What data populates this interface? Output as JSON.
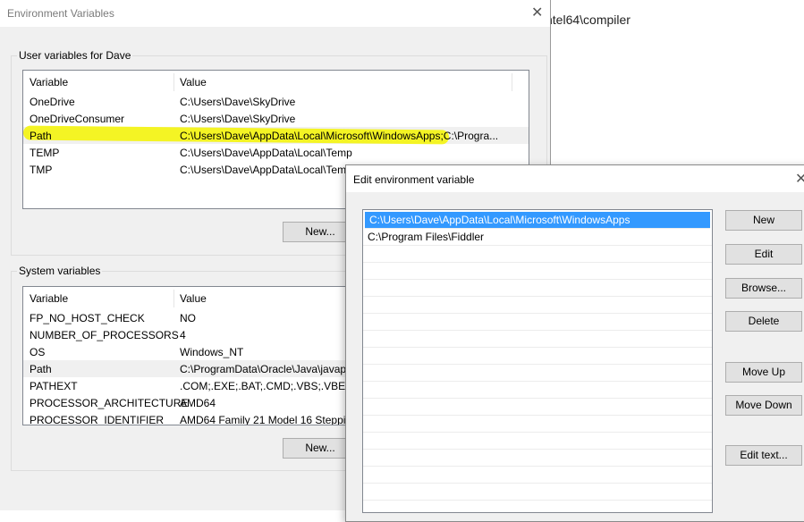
{
  "background": {
    "partial_path_text": "ntel64\\compiler"
  },
  "env_window": {
    "title": "Environment Variables",
    "user_group": {
      "label": "User variables for Dave",
      "columns": [
        "Variable",
        "Value"
      ],
      "rows": [
        {
          "variable": "OneDrive",
          "value": "C:\\Users\\Dave\\SkyDrive"
        },
        {
          "variable": "OneDriveConsumer",
          "value": "C:\\Users\\Dave\\SkyDrive"
        },
        {
          "variable": "Path",
          "value": "C:\\Users\\Dave\\AppData\\Local\\Microsoft\\WindowsApps;C:\\Progra..."
        },
        {
          "variable": "TEMP",
          "value": "C:\\Users\\Dave\\AppData\\Local\\Temp"
        },
        {
          "variable": "TMP",
          "value": "C:\\Users\\Dave\\AppData\\Local\\Temp"
        }
      ],
      "new_button": "New..."
    },
    "system_group": {
      "label": "System variables",
      "columns": [
        "Variable",
        "Value"
      ],
      "rows": [
        {
          "variable": "FP_NO_HOST_CHECK",
          "value": "NO"
        },
        {
          "variable": "NUMBER_OF_PROCESSORS",
          "value": "4"
        },
        {
          "variable": "OS",
          "value": "Windows_NT"
        },
        {
          "variable": "Path",
          "value": "C:\\ProgramData\\Oracle\\Java\\javapath"
        },
        {
          "variable": "PATHEXT",
          "value": ".COM;.EXE;.BAT;.CMD;.VBS;.VBE;.JS;"
        },
        {
          "variable": "PROCESSOR_ARCHITECTURE",
          "value": "AMD64"
        },
        {
          "variable": "PROCESSOR_IDENTIFIER",
          "value": "AMD64 Family 21 Model 16 Stepping"
        }
      ],
      "new_button": "New..."
    }
  },
  "edit_dialog": {
    "title": "Edit environment variable",
    "entries": [
      {
        "text": "C:\\Users\\Dave\\AppData\\Local\\Microsoft\\WindowsApps",
        "selected": true
      },
      {
        "text": "C:\\Program Files\\Fiddler",
        "selected": false
      }
    ],
    "buttons": {
      "new": "New",
      "edit": "Edit",
      "browse": "Browse...",
      "delete": "Delete",
      "move_up": "Move Up",
      "move_down": "Move Down",
      "edit_text": "Edit text..."
    }
  },
  "colors": {
    "selection": "#3399ff",
    "highlight_mark": "#f4f500",
    "window_bg": "#f0f0f0"
  }
}
